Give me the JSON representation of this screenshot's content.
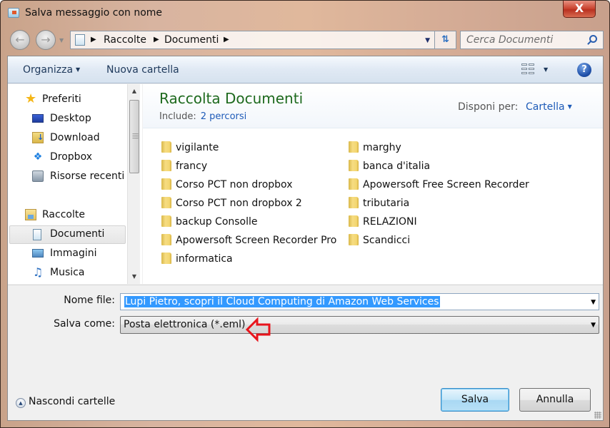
{
  "window": {
    "title": "Salva messaggio con nome",
    "close_label": "X"
  },
  "navigation": {
    "back_icon": "arrow-left-icon",
    "forward_icon": "arrow-right-icon",
    "breadcrumb": [
      "Raccolte",
      "Documenti"
    ],
    "search_placeholder": "Cerca Documenti"
  },
  "toolbar": {
    "organize_label": "Organizza",
    "new_folder_label": "Nuova cartella",
    "help_label": "?"
  },
  "sidebar": {
    "favorites": {
      "label": "Preferiti",
      "items": [
        {
          "label": "Desktop",
          "icon": "desktop-icon"
        },
        {
          "label": "Download",
          "icon": "download-folder-icon"
        },
        {
          "label": "Dropbox",
          "icon": "dropbox-icon"
        },
        {
          "label": "Risorse recenti",
          "icon": "recent-places-icon"
        }
      ]
    },
    "libraries": {
      "label": "Raccolte",
      "items": [
        {
          "label": "Documenti",
          "icon": "documents-icon",
          "selected": true
        },
        {
          "label": "Immagini",
          "icon": "pictures-icon"
        },
        {
          "label": "Musica",
          "icon": "music-icon"
        }
      ]
    }
  },
  "content": {
    "library_title": "Raccolta Documenti",
    "include_label": "Include:",
    "include_paths": "2 percorsi",
    "arrange_label": "Disponi per:",
    "arrange_value": "Cartella",
    "folders_col1": [
      "vigilante",
      "francy",
      "Corso PCT non dropbox",
      "Corso PCT non dropbox 2",
      "backup Consolle",
      "Apowersoft Screen Recorder Pro",
      "informatica"
    ],
    "folders_col2": [
      "marghy",
      "banca d'italia",
      "Apowersoft Free Screen Recorder",
      "tributaria",
      "RELAZIONI",
      "Scandicci"
    ]
  },
  "form": {
    "filename_label": "Nome file:",
    "filename_value": "Lupi Pietro, scopri il Cloud Computing di Amazon Web Services",
    "savetype_label": "Salva come:",
    "savetype_value": "Posta elettronica (*.eml)",
    "annotation_color": "#e8141c"
  },
  "footer": {
    "hide_folders_label": "Nascondi cartelle",
    "save_label": "Salva",
    "cancel_label": "Annulla"
  }
}
